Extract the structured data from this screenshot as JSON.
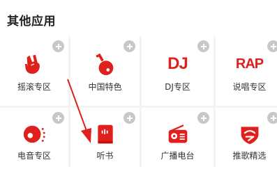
{
  "section": {
    "title": "其他应用"
  },
  "accent_color": "#e0201c",
  "apps": [
    {
      "label": "摇滚专区",
      "icon": "rock-hand-icon"
    },
    {
      "label": "中国特色",
      "icon": "pipa-instrument-icon"
    },
    {
      "label": "DJ专区",
      "icon": "dj-text-icon",
      "icon_text": "DJ"
    },
    {
      "label": "说唱专区",
      "icon": "rap-text-icon",
      "icon_text": "RAP"
    },
    {
      "label": "电音专区",
      "icon": "electronic-music-icon"
    },
    {
      "label": "听书",
      "icon": "book-audio-icon"
    },
    {
      "label": "广播电台",
      "icon": "radio-icon"
    },
    {
      "label": "推歌精选",
      "icon": "recommend-song-icon"
    }
  ],
  "add_button_icon": "plus-icon"
}
